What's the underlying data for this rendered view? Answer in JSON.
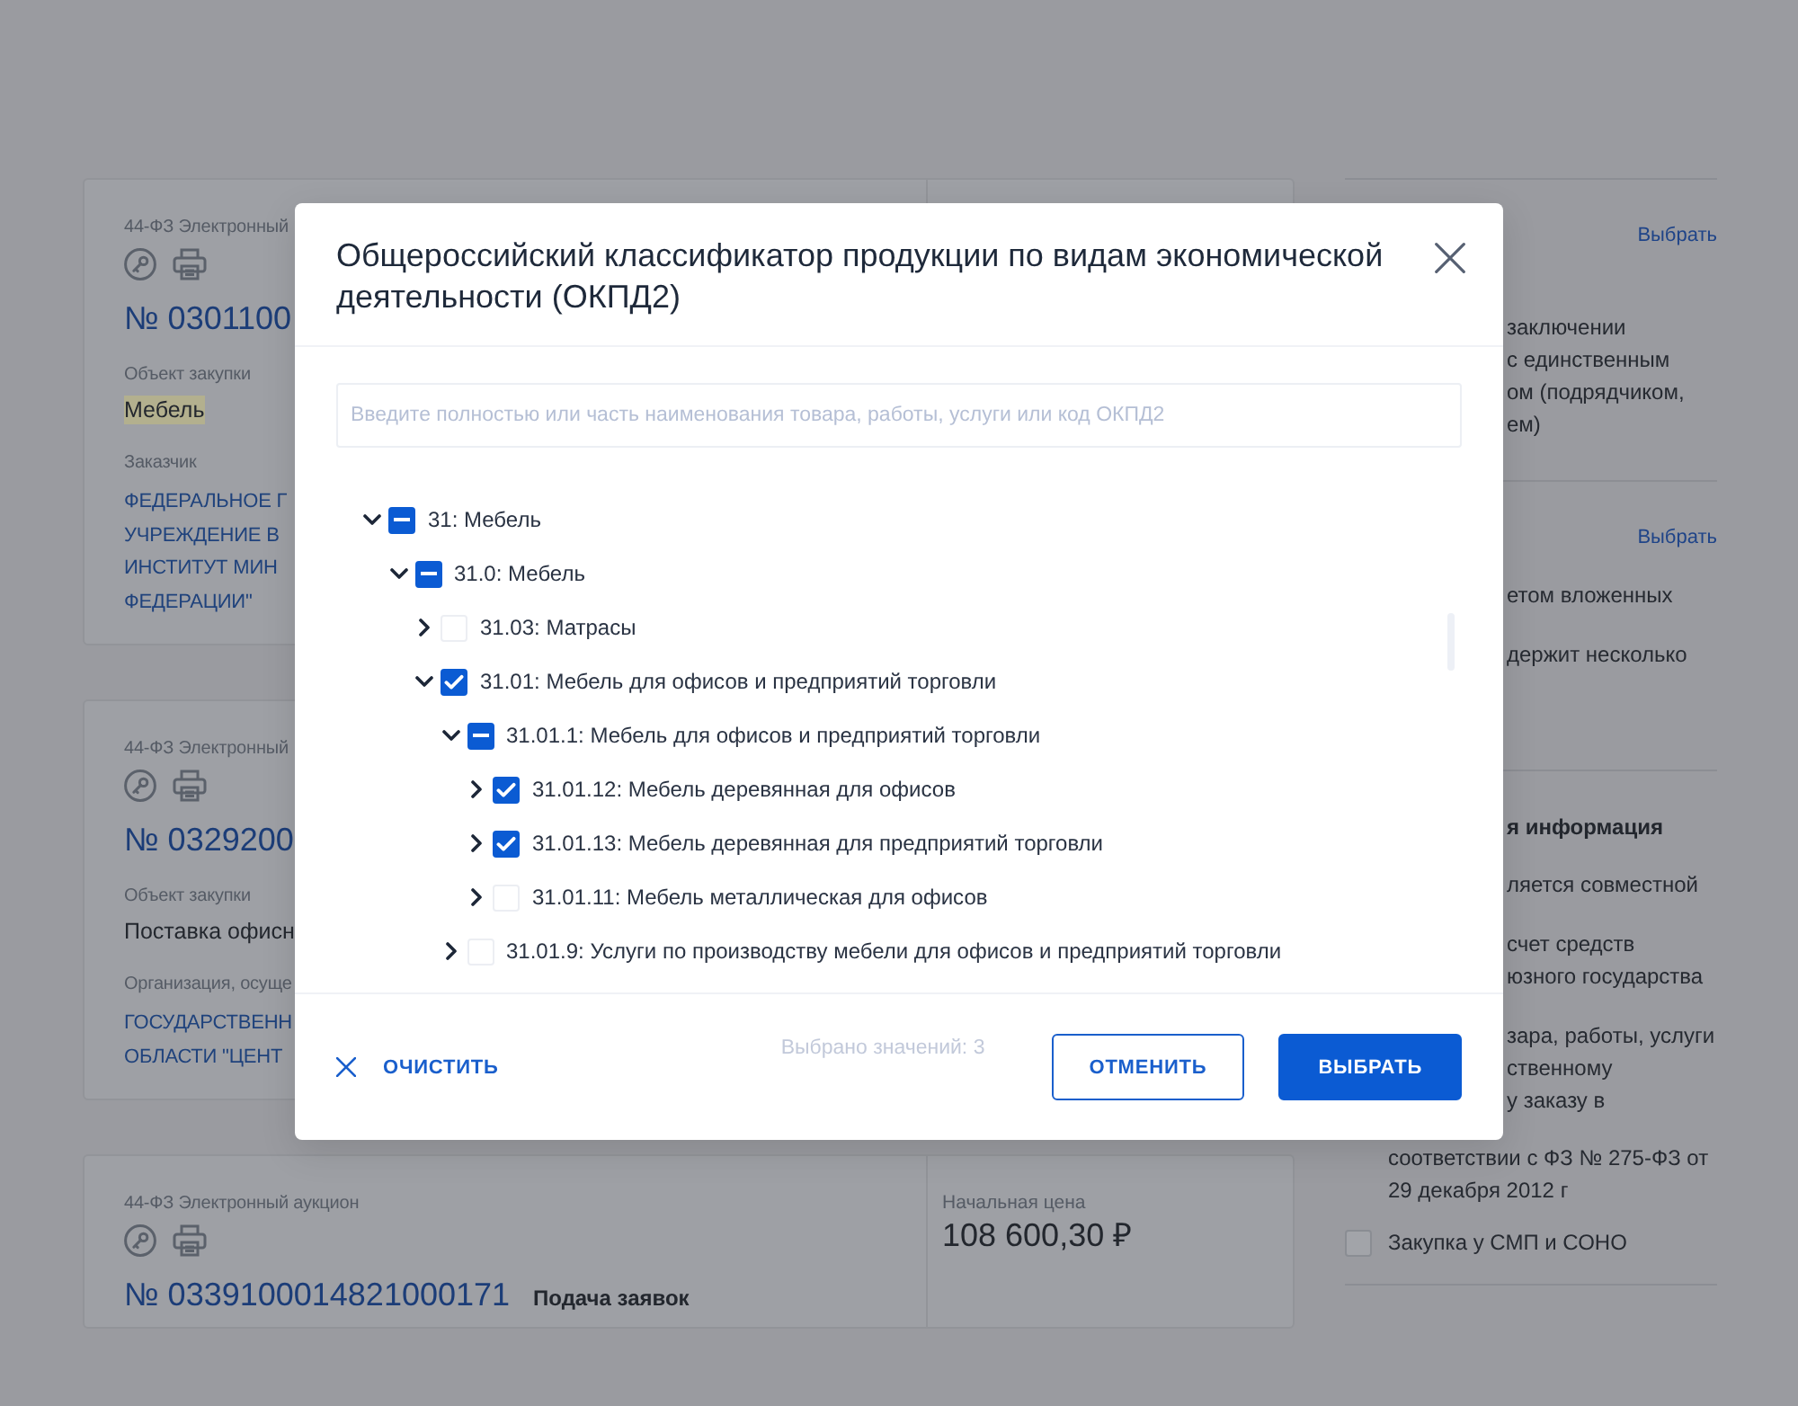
{
  "cards": [
    {
      "type_label": "44-ФЗ Электронный",
      "number": "№ 0301100",
      "subject_label": "Объект закупки",
      "subject": "Мебель",
      "subject_highlighted": true,
      "org_label": "Заказчик",
      "org_lines": [
        "ФЕДЕРАЛЬНОЕ Г",
        "УЧРЕЖДЕНИЕ В",
        "ИНСТИТУТ МИН",
        "ФЕДЕРАЦИИ\""
      ]
    },
    {
      "type_label": "44-ФЗ Электронный",
      "number": "№ 0329200",
      "subject_label": "Объект закупки",
      "subject": "Поставка офисн",
      "subject_highlighted": false,
      "org_label": "Организация, осуще",
      "org_lines": [
        "ГОСУДАРСТВЕНН",
        "ОБЛАСТИ \"ЦЕНТ"
      ]
    },
    {
      "type_label": "44-ФЗ Электронный аукцион",
      "number": "№ 0339100014821000171",
      "status": "Подача заявок",
      "price_label": "Начальная цена",
      "price": "108 600,30 ₽"
    }
  ],
  "sidebar": {
    "sections": [
      {
        "link": "Выбрать",
        "options": [
          {
            "lines": [
              "заключении",
              "с единственным",
              "ом (подрядчиком,",
              "ем)"
            ]
          }
        ]
      },
      {
        "link": "Выбрать",
        "options": [
          {
            "lines": [
              "етом вложенных"
            ]
          },
          {
            "lines": [
              "держит несколько"
            ]
          }
        ]
      },
      {
        "heading": "я информация",
        "options": [
          {
            "lines": [
              "ляется совместной"
            ]
          },
          {
            "lines": [
              "счет средств",
              "юзного государства"
            ]
          },
          {
            "lines": [
              "зара, работы, услуги",
              "ственному",
              "у заказу в"
            ],
            "tail": [
              "соответствии с ФЗ № 275-ФЗ от",
              "29 декабря 2012 г"
            ]
          }
        ],
        "checkbox_option": {
          "label": "Закупка у СМП и СОНО",
          "checked": false
        }
      }
    ]
  },
  "dialog": {
    "title": "Общероссийский классификатор продукции по видам экономической деятельности (ОКПД2)",
    "search": {
      "placeholder": "Введите полностью или часть наименования товара, работы, услуги или код ОКПД2"
    },
    "tree": [
      {
        "label": "31: Мебель",
        "expanded": true,
        "checked": true,
        "indeterminate": true,
        "children": [
          {
            "label": "31.0: Мебель",
            "expanded": true,
            "checked": true,
            "indeterminate": true,
            "children": [
              {
                "label": "31.03: Матрасы",
                "expanded": false,
                "checked": false,
                "indeterminate": false
              },
              {
                "label": "31.01: Мебель для офисов и предприятий торговли",
                "expanded": true,
                "checked": true,
                "indeterminate": false,
                "children": [
                  {
                    "label": "31.01.1: Мебель для офисов и предприятий торговли",
                    "expanded": true,
                    "checked": true,
                    "indeterminate": true,
                    "children": [
                      {
                        "label": "31.01.12: Мебель деревянная для офисов",
                        "expanded": false,
                        "checked": true,
                        "indeterminate": false
                      },
                      {
                        "label": "31.01.13: Мебель деревянная для предприятий торговли",
                        "expanded": false,
                        "checked": true,
                        "indeterminate": false
                      },
                      {
                        "label": "31.01.11: Мебель металлическая для офисов",
                        "expanded": false,
                        "checked": false,
                        "indeterminate": false
                      }
                    ]
                  },
                  {
                    "label": "31.01.9: Услуги по производству мебели для офисов и предприятий торговли",
                    "expanded": false,
                    "checked": false,
                    "indeterminate": false
                  }
                ]
              }
            ]
          }
        ]
      }
    ],
    "footer": {
      "clear": "ОЧИСТИТЬ",
      "counter": "Выбрано значений: 3",
      "buttons": [
        {
          "label": "ОТМЕНИТЬ",
          "kind": "secondary"
        },
        {
          "label": "ВЫБРАТЬ",
          "kind": "primary"
        }
      ]
    }
  }
}
